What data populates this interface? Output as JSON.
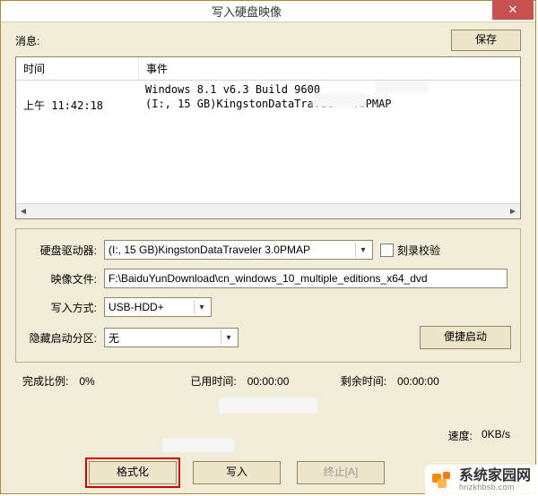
{
  "window": {
    "title": "写入硬盘映像"
  },
  "messages": {
    "label": "消息:",
    "save_btn": "保存"
  },
  "log": {
    "col_time": "时间",
    "col_event": "事件",
    "rows": [
      {
        "time": "",
        "event": "Windows 8.1 v6.3 Build 9600"
      },
      {
        "time": "上午 11:42:18",
        "event": "(I:, 15 GB)KingstonDataTravel   .0PMAP"
      }
    ]
  },
  "form": {
    "drive_label": "硬盘驱动器:",
    "drive_value": "(I:, 15 GB)KingstonDataTraveler 3.0PMAP",
    "verify_label": "刻录校验",
    "image_label": "映像文件:",
    "image_value": "F:\\BaiduYunDownload\\cn_windows_10_multiple_editions_x64_dvd",
    "write_mode_label": "写入方式:",
    "write_mode_value": "USB-HDD+",
    "hide_boot_label": "隐藏启动分区:",
    "hide_boot_value": "无",
    "quick_boot_btn": "便捷启动"
  },
  "progress": {
    "done_ratio_label": "完成比例:",
    "done_ratio_value": "0%",
    "elapsed_label": "已用时间:",
    "elapsed_value": "00:00:00",
    "remain_label": "剩余时间:",
    "remain_value": "00:00:00",
    "speed_label": "速度:",
    "speed_value": "0KB/s"
  },
  "buttons": {
    "format": "格式化",
    "write": "写入",
    "abort": "终止[A]",
    "back": ""
  },
  "watermark": {
    "name": "系统家园网",
    "url": "hnzkhbsb.com"
  }
}
